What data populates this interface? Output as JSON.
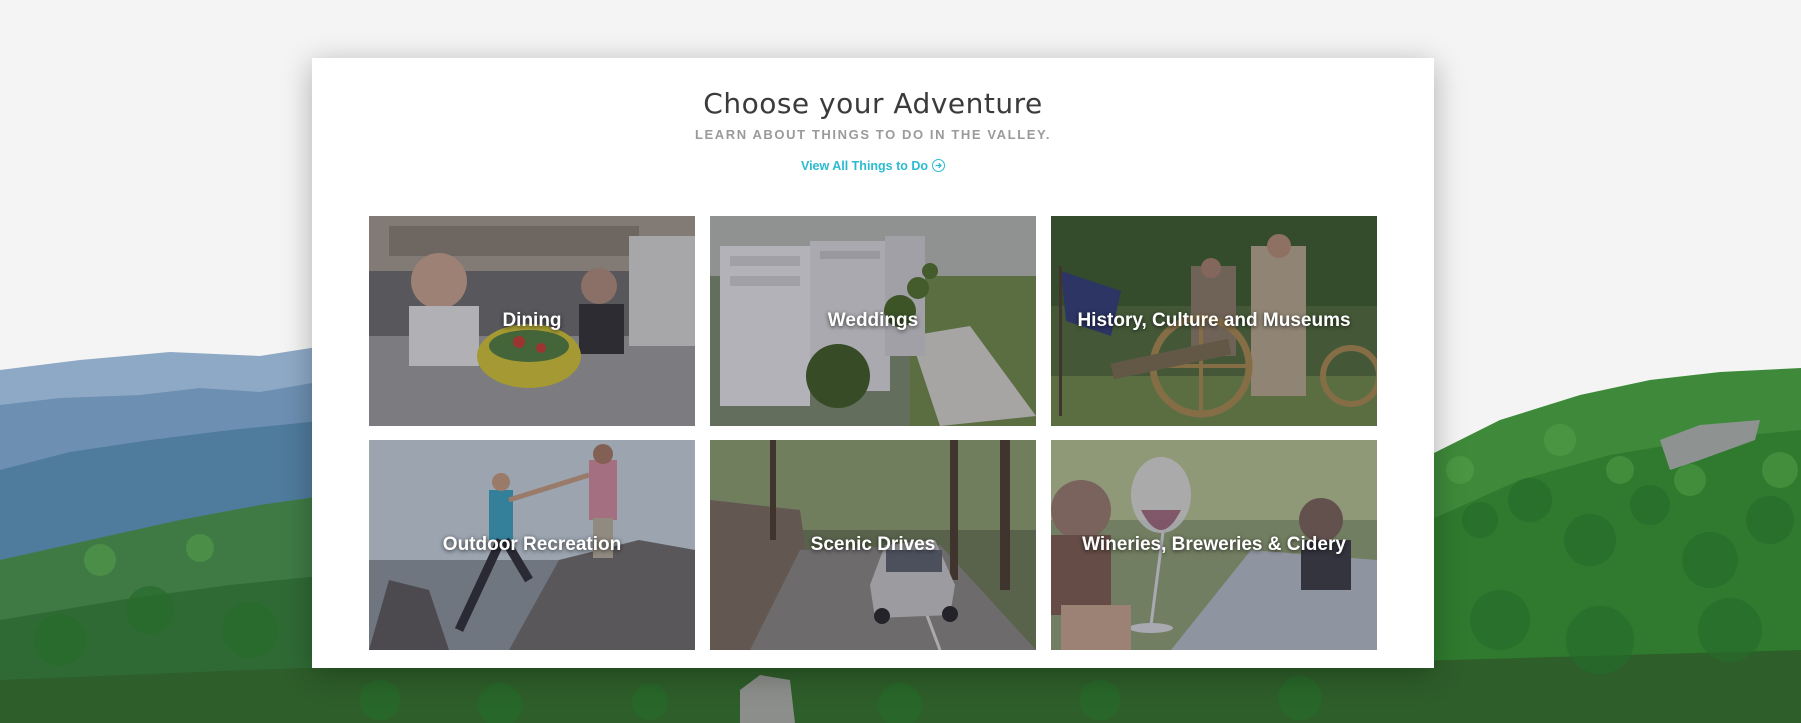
{
  "section": {
    "title": "Choose your Adventure",
    "subtitle": "LEARN ABOUT THINGS TO DO IN THE VALLEY.",
    "view_all_label": "View All Things to Do"
  },
  "icons": {
    "view_all": "arrow-right-circle-icon"
  },
  "tiles": [
    {
      "label": "Dining"
    },
    {
      "label": "Weddings"
    },
    {
      "label": "History, Culture and Museums"
    },
    {
      "label": "Outdoor Recreation"
    },
    {
      "label": "Scenic Drives"
    },
    {
      "label": "Wineries, Breweries & Cidery"
    }
  ],
  "colors": {
    "accent": "#2bbbd0",
    "title": "#3b3b3b",
    "subtitle": "#9a9a9a"
  }
}
